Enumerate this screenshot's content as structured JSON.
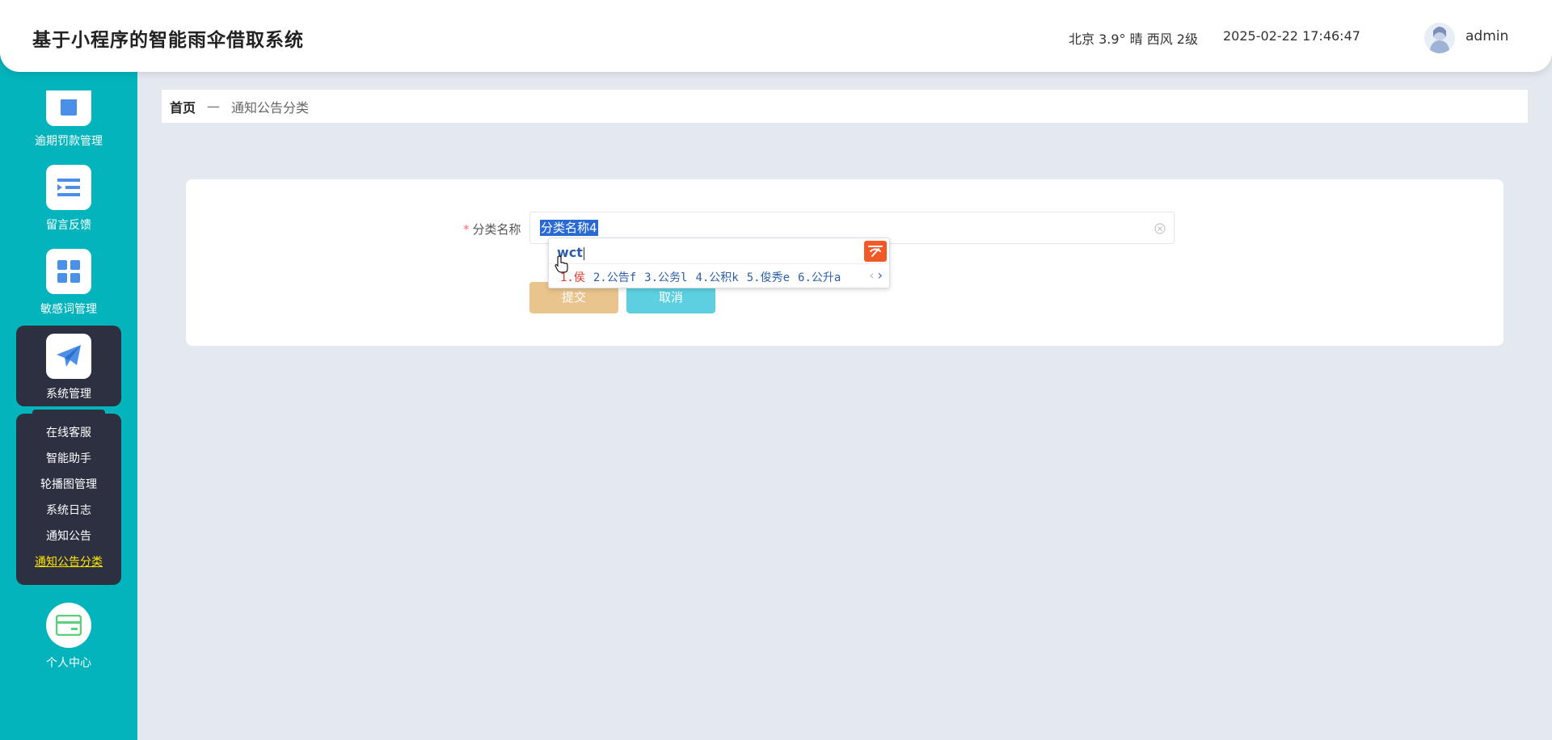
{
  "header": {
    "title": "基于小程序的智能雨伞借取系统",
    "weather": "北京  3.9°  晴  西风  2级",
    "datetime": "2025-02-22 17:46:47",
    "username": "admin"
  },
  "sidebar": {
    "items": [
      {
        "label": "逾期罚款管理",
        "icon": "shop-icon"
      },
      {
        "label": "留言反馈",
        "icon": "list-indent-icon"
      },
      {
        "label": "敏感词管理",
        "icon": "grid-icon"
      },
      {
        "label": "系统管理",
        "icon": "paper-plane-icon"
      },
      {
        "label": "个人中心",
        "icon": "card-icon"
      }
    ],
    "submenu": [
      "在线客服",
      "智能助手",
      "轮播图管理",
      "系统日志",
      "通知公告",
      "通知公告分类"
    ],
    "accent_color": "#04b4bc",
    "active_submenu_color": "#ffe600"
  },
  "breadcrumb": {
    "home": "首页",
    "separator": "—",
    "current": "通知公告分类"
  },
  "form": {
    "field_label": "分类名称",
    "field_required": "*",
    "field_value": "分类名称4",
    "submit_label": "提交",
    "cancel_label": "取消"
  },
  "ime": {
    "composition": "wct",
    "candidates": [
      "1.侯",
      "2.公告f",
      "3.公务l",
      "4.公积k",
      "5.俊秀e",
      "6.公升a"
    ],
    "prev": "‹",
    "next": "›"
  }
}
